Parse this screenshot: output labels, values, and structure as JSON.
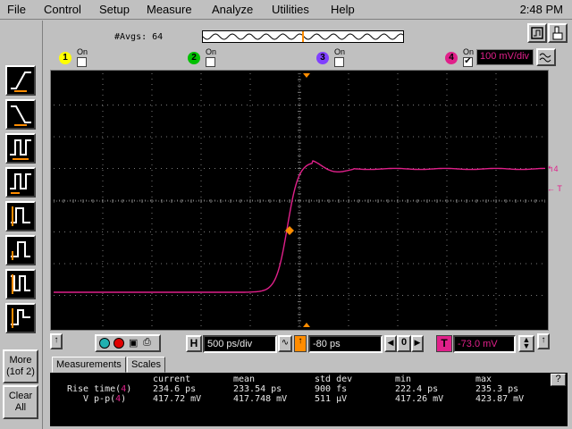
{
  "menu": [
    "File",
    "Control",
    "Setup",
    "Measure",
    "Analyze",
    "Utilities",
    "Help"
  ],
  "clock": "2:48 PM",
  "acquisition": {
    "averages_label": "#Avgs: 64"
  },
  "channels": [
    {
      "number": "1",
      "on_label": "On",
      "enabled": false,
      "color": "#ffff00"
    },
    {
      "number": "2",
      "on_label": "On",
      "enabled": false,
      "color": "#00c000"
    },
    {
      "number": "3",
      "on_label": "On",
      "enabled": false,
      "color": "#8040ff"
    },
    {
      "number": "4",
      "on_label": "On",
      "enabled": true,
      "color": "#e0208a",
      "scale": "100 mV/div"
    }
  ],
  "screen": {
    "trace_color": "#e0208a",
    "grid_color": "#7a7a7a",
    "marker_color": "#ff8c00",
    "ch4_marker": "4",
    "trigger_marker": "T"
  },
  "horizontal": {
    "h_label": "H",
    "timebase": "500 ps/div",
    "delay": "-80 ps",
    "step_value": "0"
  },
  "trigger": {
    "t_label": "T",
    "level": "-73.0 mV"
  },
  "side_buttons": {
    "more": "More (1of 2)",
    "clear": "Clear All"
  },
  "measurements": {
    "tabs": [
      "Measurements",
      "Scales"
    ],
    "help": "?",
    "columns": [
      "current",
      "mean",
      "std dev",
      "min",
      "max"
    ],
    "rows": [
      {
        "name": "Rise time(",
        "src": "4",
        "values": [
          "234.6 ps",
          "233.54 ps",
          "900 fs",
          "222.4 ps",
          "235.3 ps"
        ]
      },
      {
        "name": "V p-p(",
        "src": "4",
        "values": [
          "417.72 mV",
          "417.748 mV",
          "511 µV",
          "417.26 mV",
          "423.87 mV"
        ]
      }
    ]
  }
}
